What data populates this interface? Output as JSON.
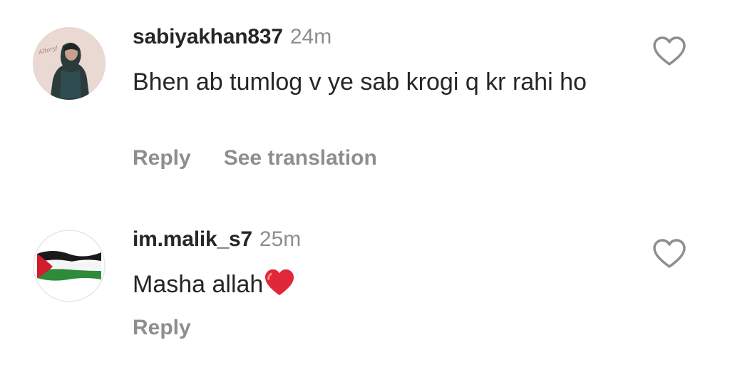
{
  "comments": [
    {
      "username": "sabiyakhan837",
      "time": "24m",
      "text": "Bhen ab tumlog v ye sab krogi q kr rahi ho",
      "actions": {
        "reply": "Reply",
        "translate": "See translation"
      }
    },
    {
      "username": "im.malik_s7",
      "time": "25m",
      "text": "Masha allah",
      "emoji": "red-heart",
      "actions": {
        "reply": "Reply"
      }
    }
  ],
  "colors": {
    "text": "#262626",
    "secondary": "#8e8e8e",
    "heart_emoji": "#e0283a",
    "flag_green": "#2e8b3a",
    "flag_red": "#d01e2e"
  },
  "icons": [
    "heart-outline-icon",
    "red-heart-emoji"
  ]
}
